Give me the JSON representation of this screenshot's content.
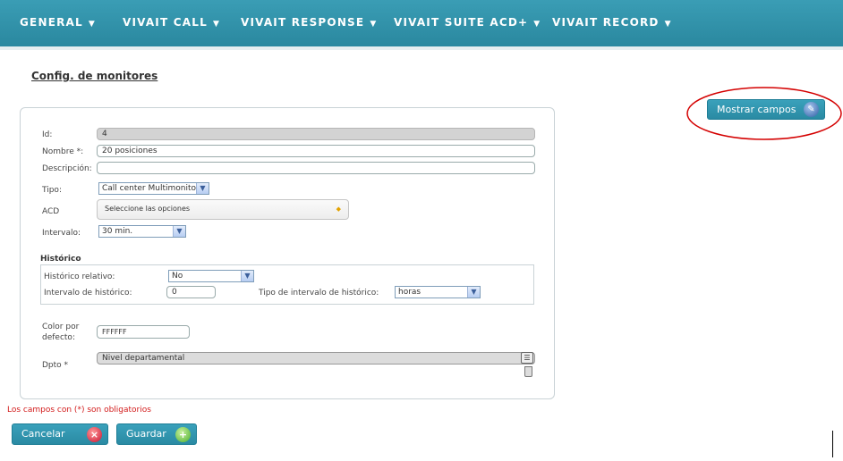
{
  "nav": {
    "items": [
      "GENERAL",
      "VIVAIT CALL",
      "VIVAIT RESPONSE",
      "VIVAIT SUITE ACD+",
      "VIVAIT RECORD"
    ],
    "caret": "▼"
  },
  "page_title": "Config. de monitores",
  "show_fields_label": "Mostrar campos",
  "form": {
    "id_label": "Id:",
    "id_value": "4",
    "nombre_label": "Nombre *:",
    "nombre_value": "20 posiciones",
    "descripcion_label": "Descripción:",
    "descripcion_value": "",
    "tipo_label": "Tipo:",
    "tipo_value": "Call center Multimonitor",
    "acd_label": "ACD",
    "acd_value": "Seleccione las opciones",
    "intervalo_label": "Intervalo:",
    "intervalo_value": "30 min."
  },
  "historico": {
    "title": "Histórico",
    "relativo_label": "Histórico relativo:",
    "relativo_value": "No",
    "intervalo_label": "Intervalo de histórico:",
    "intervalo_value": "0",
    "tipo_label": "Tipo de intervalo de histórico:",
    "tipo_value": "horas"
  },
  "color": {
    "label_line1": "Color por",
    "label_line2": "defecto:",
    "value": "FFFFFF"
  },
  "dpto": {
    "label": "Dpto *",
    "value": "Nivel departamental"
  },
  "required_note": "Los campos con (*) son obligatorios",
  "buttons": {
    "cancel": "Cancelar",
    "save": "Guardar"
  },
  "colors": {
    "nav": "#2f93ab",
    "button": "#2f93ab",
    "annotation": "#d40000",
    "required": "#d21a1a"
  },
  "icons": [
    "chevron-down-icon",
    "pencil-icon",
    "list-icon",
    "trash-icon",
    "cancel-icon",
    "add-icon"
  ]
}
